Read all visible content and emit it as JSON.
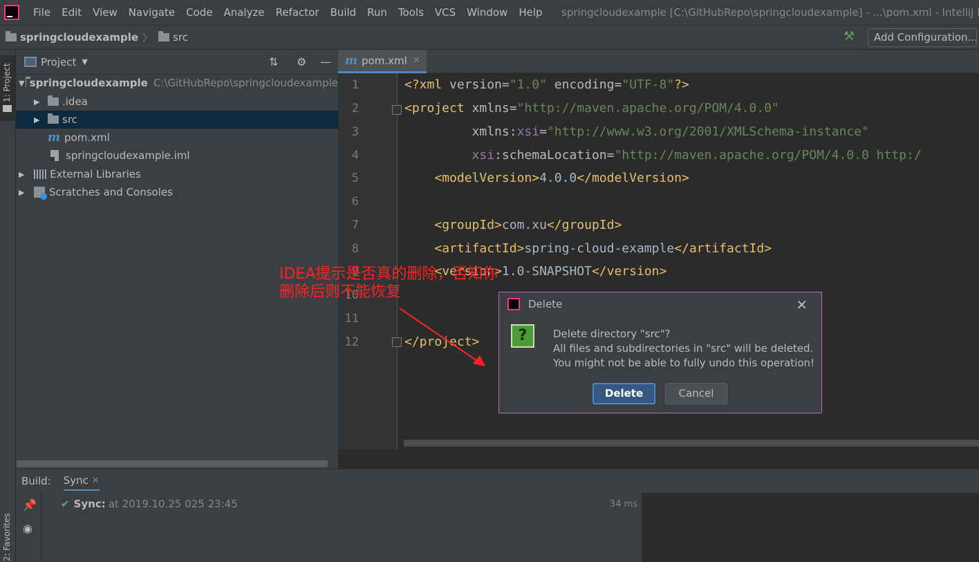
{
  "menu": [
    "File",
    "Edit",
    "View",
    "Navigate",
    "Code",
    "Analyze",
    "Refactor",
    "Build",
    "Run",
    "Tools",
    "VCS",
    "Window",
    "Help"
  ],
  "window_title": "springcloudexample [C:\\GitHubRepo\\springcloudexample] - ...\\pom.xml - IntelliJ ID",
  "breadcrumb": {
    "project": "springcloudexample",
    "folder": "src"
  },
  "toolbar": {
    "add_configuration": "Add Configuration..."
  },
  "left_strip": {
    "project_tool": "1: Project",
    "favorites_tool": "2: Favorites"
  },
  "project_panel": {
    "title": "Project",
    "tree": {
      "root_name": "springcloudexample",
      "root_path": "C:\\GitHubRepo\\springcloudexample",
      "idea": ".idea",
      "src": "src",
      "pom": "pom.xml",
      "iml": "springcloudexample.iml",
      "external_libraries": "External Libraries",
      "scratches": "Scratches and Consoles"
    }
  },
  "editor": {
    "tab_label": "pom.xml",
    "line_numbers": [
      "1",
      "2",
      "3",
      "4",
      "5",
      "6",
      "7",
      "8",
      "9",
      "10",
      "11",
      "12"
    ],
    "code": {
      "l1_tag_open": "<?xml ",
      "l1_attr1": "version",
      "l1_eq": "=",
      "l1_val1": "\"1.0\"",
      "l1_attr2": " encoding",
      "l1_val2": "\"UTF-8\"",
      "l1_close": "?>",
      "l2_tag": "<project ",
      "l2_attr": "xmlns",
      "l2_val": "\"http://maven.apache.org/POM/4.0.0\"",
      "l3_indent": "         ",
      "l3_attr": "xmlns:",
      "l3_ns": "xsi",
      "l3_val": "\"http://www.w3.org/2001/XMLSchema-instance\"",
      "l4_indent": "         ",
      "l4_ns": "xsi",
      "l4_attr": ":schemaLocation",
      "l4_val": "\"http://maven.apache.org/POM/4.0.0 http:/",
      "l5_indent": "    ",
      "l5_open": "<modelVersion>",
      "l5_text": "4.0.0",
      "l5_close": "</modelVersion>",
      "l7_indent": "    ",
      "l7_open": "<groupId>",
      "l7_text": "com.xu",
      "l7_close": "</groupId>",
      "l8_indent": "    ",
      "l8_open": "<artifactId>",
      "l8_text": "spring-cloud-example",
      "l8_close": "</artifactId>",
      "l9_indent": "    ",
      "l9_open": "<version>",
      "l9_text": "1.0-SNAPSHOT",
      "l9_close": "</version>",
      "l12_close": "</project>"
    }
  },
  "annotation": {
    "line1": "IDEA提示是否真的删除，否知你",
    "line2": "删除后则不能恢复"
  },
  "dialog": {
    "title": "Delete",
    "message_line1": "Delete directory \"src\"?",
    "message_line2": "All files and subdirectories in \"src\" will be deleted.",
    "message_line3": "You might not be able to fully undo this operation!",
    "ok_label": "Delete",
    "cancel_label": "Cancel"
  },
  "build": {
    "label": "Build:",
    "tab": "Sync",
    "sync_bold": "Sync:",
    "sync_detail": "at 2019.10.25 025 23:45",
    "duration": "34 ms"
  },
  "colors": {
    "accent": "#4a88c7",
    "annotation": "#ff2222",
    "dialog_border": "#b46bc0",
    "xml_tag": "#e8bf6a",
    "xml_string": "#6a8759"
  }
}
